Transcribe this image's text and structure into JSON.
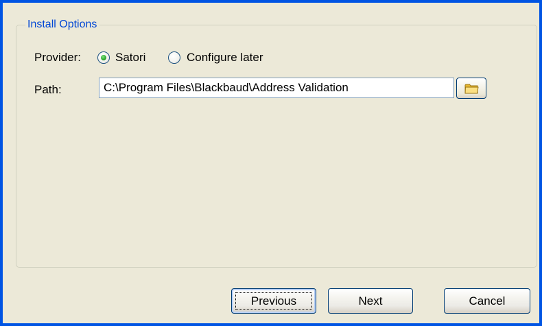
{
  "group": {
    "title": "Install Options"
  },
  "provider": {
    "label": "Provider:",
    "options": [
      {
        "label": "Satori",
        "selected": true
      },
      {
        "label": "Configure later",
        "selected": false
      }
    ]
  },
  "path": {
    "label": "Path:",
    "value": "C:\\Program Files\\Blackbaud\\Address Validation"
  },
  "icons": {
    "browse": "folder-icon"
  },
  "footer": {
    "previous_label": "Previous",
    "next_label": "Next",
    "cancel_label": "Cancel"
  },
  "colors": {
    "window_frame": "#0054e3",
    "background": "#ece9d8",
    "group_title": "#0046d5",
    "radio_selected": "#2da72d"
  }
}
